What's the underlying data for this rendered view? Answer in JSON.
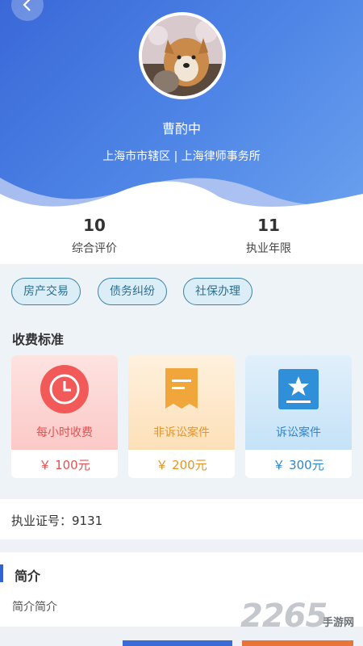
{
  "profile": {
    "name": "曹酌中",
    "location": "上海市市辖区 | 上海律师事务所"
  },
  "stats": [
    {
      "value": "10",
      "label": "综合评价"
    },
    {
      "value": "11",
      "label": "执业年限"
    }
  ],
  "tags": [
    "房产交易",
    "债务纠纷",
    "社保办理"
  ],
  "fees": {
    "title": "收费标准",
    "cards": [
      {
        "label": "每小时收费",
        "price": "￥ 100元",
        "icon": "clock-icon",
        "color": "#f25a5a"
      },
      {
        "label": "非诉讼案件",
        "price": "￥ 200元",
        "icon": "document-icon",
        "color": "#f0a63a"
      },
      {
        "label": "诉讼案件",
        "price": "￥ 300元",
        "icon": "star-document-icon",
        "color": "#2f8fd8"
      }
    ]
  },
  "license": {
    "text": "执业证号：9131"
  },
  "intro": {
    "title": "简介",
    "text": "简介简介"
  },
  "watermark": {
    "number": "2265",
    "text": "手游网"
  },
  "colors": {
    "header": "#3a68d8",
    "accent": "#2f63d6",
    "tag_border": "#3b82a6"
  }
}
